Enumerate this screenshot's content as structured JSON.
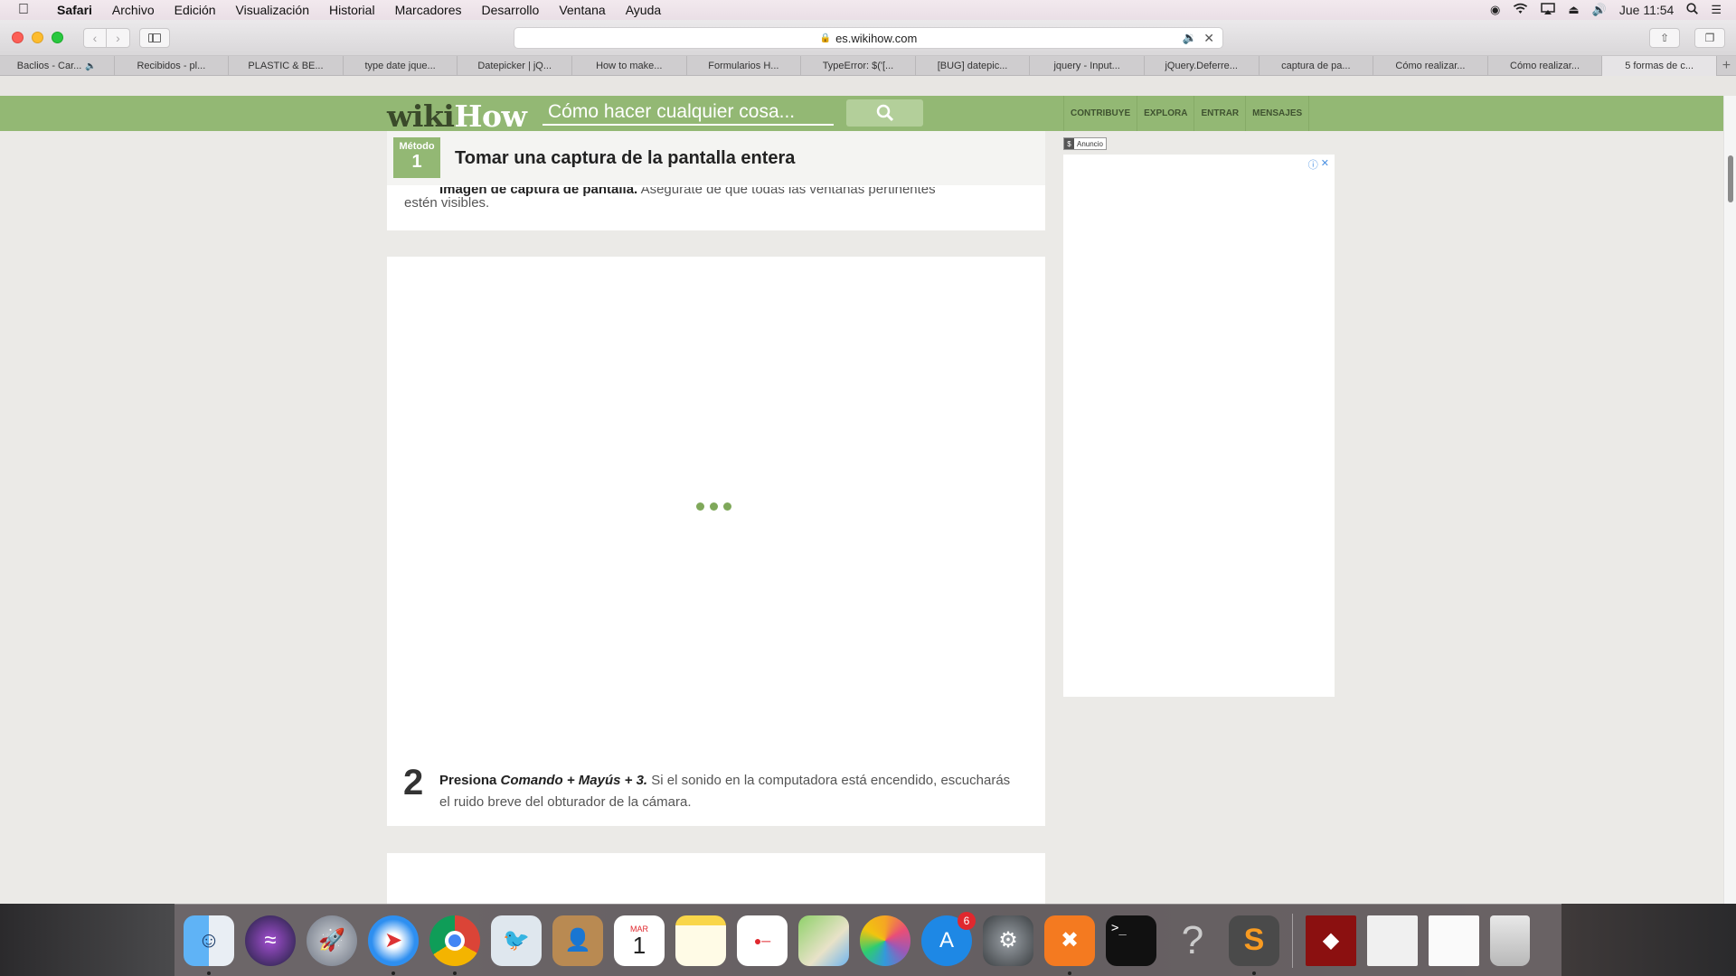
{
  "menubar": {
    "app": "Safari",
    "menus": [
      "Archivo",
      "Edición",
      "Visualización",
      "Historial",
      "Marcadores",
      "Desarrollo",
      "Ventana",
      "Ayuda"
    ],
    "clock": "Jue 11:54"
  },
  "toolbar": {
    "url": "es.wikihow.com"
  },
  "tabs": [
    {
      "label": "Baclios - Car..."
    },
    {
      "label": "Recibidos - pl..."
    },
    {
      "label": "PLASTIC & BE..."
    },
    {
      "label": "type date jque..."
    },
    {
      "label": "Datepicker | jQ..."
    },
    {
      "label": "How to make..."
    },
    {
      "label": "Formularios H..."
    },
    {
      "label": "TypeError: $('[..."
    },
    {
      "label": "[BUG] datepic..."
    },
    {
      "label": "jquery - Input..."
    },
    {
      "label": "jQuery.Deferre..."
    },
    {
      "label": "captura de pa..."
    },
    {
      "label": "Cómo realizar..."
    },
    {
      "label": "Cómo realizar..."
    },
    {
      "label": "5 formas de c..."
    }
  ],
  "wikihow": {
    "logo_wiki": "wiki",
    "logo_how": "How",
    "search_placeholder": "Cómo hacer cualquier cosa...",
    "nav": [
      "CONTRIBUYE",
      "EXPLORA",
      "ENTRAR",
      "MENSAJES"
    ]
  },
  "method": {
    "label": "Método",
    "number": "1",
    "title": "Tomar una captura de la pantalla entera"
  },
  "step1": {
    "cut_bold": "Imagen de captura de pantalla.",
    "cut_rest": " Asegúrate de que todas las ventanas pertinentes",
    "tail": "estén visibles."
  },
  "step2": {
    "number": "2",
    "bold_lead": "Presiona ",
    "bold_italic": "Comando + Mayús + 3.",
    "text": " Si el sonido en la computadora está encendido, escucharás el ruido breve del obturador de la cámara."
  },
  "ad": {
    "label": "Anuncio"
  },
  "dock": {
    "app_store_badge": "6",
    "calendar_month": "MAR",
    "calendar_day": "1"
  },
  "colors": {
    "wikihow_green": "#93b874",
    "wikihow_dark": "#3a4a2a"
  }
}
